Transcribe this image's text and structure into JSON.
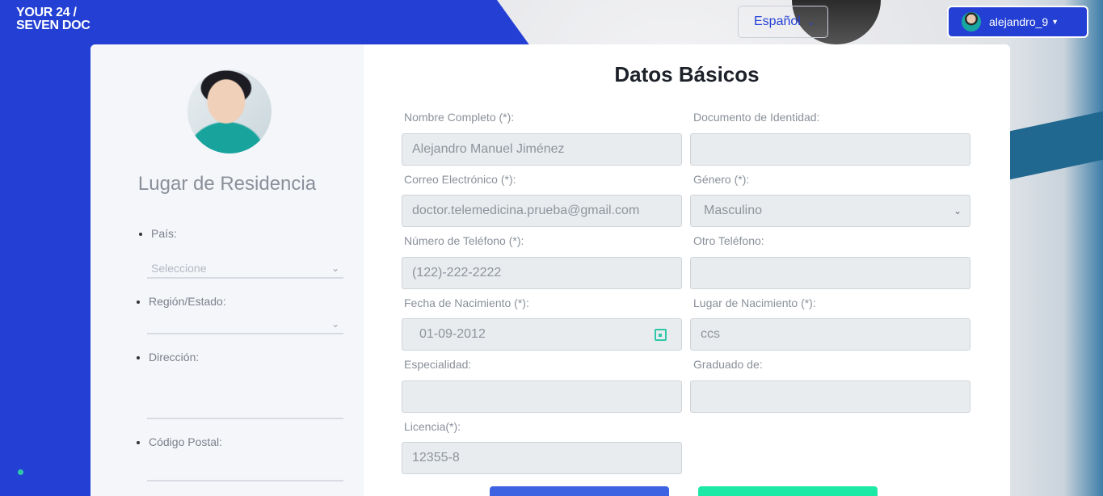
{
  "header": {
    "logo_line1": "YOUR 24 /",
    "logo_line2": "SEVEN DOC",
    "language": "Español",
    "username": "alejandro_9"
  },
  "sidebar": {
    "title": "Lugar de Residencia",
    "country_label": "País:",
    "country_placeholder": "Seleccione",
    "region_label": "Región/Estado:",
    "address_label": "Dirección:",
    "postal_label": "Código Postal:"
  },
  "form": {
    "title": "Datos Básicos",
    "full_name_label": "Nombre Completo (*):",
    "full_name": "Alejandro Manuel Jiménez",
    "id_label": "Documento de Identidad:",
    "id_value": "",
    "email_label": "Correo Electrónico (*):",
    "email": "doctor.telemedicina.prueba@gmail.com",
    "gender_label": "Género (*):",
    "gender": "Masculino",
    "phone_label": "Número de Teléfono (*):",
    "phone": "(122)-222-2222",
    "other_phone_label": "Otro Teléfono:",
    "other_phone": "",
    "birth_date_label": "Fecha de Nacimiento (*):",
    "birth_date": "01-09-2012",
    "birth_place_label": "Lugar de Nacimiento (*):",
    "birth_place": "ccs",
    "specialty_label": "Especialidad:",
    "specialty": "",
    "graduated_label": "Graduado de:",
    "graduated": "",
    "license_label": "Licencia(*):",
    "license": "12355-8"
  },
  "colors": {
    "brand_blue": "#2440d4",
    "accent_green": "#1de9a6",
    "button_blue": "#3d63e3"
  },
  "icons": {
    "calendar": "calendar-icon",
    "chevron": "chevron-down-icon"
  }
}
